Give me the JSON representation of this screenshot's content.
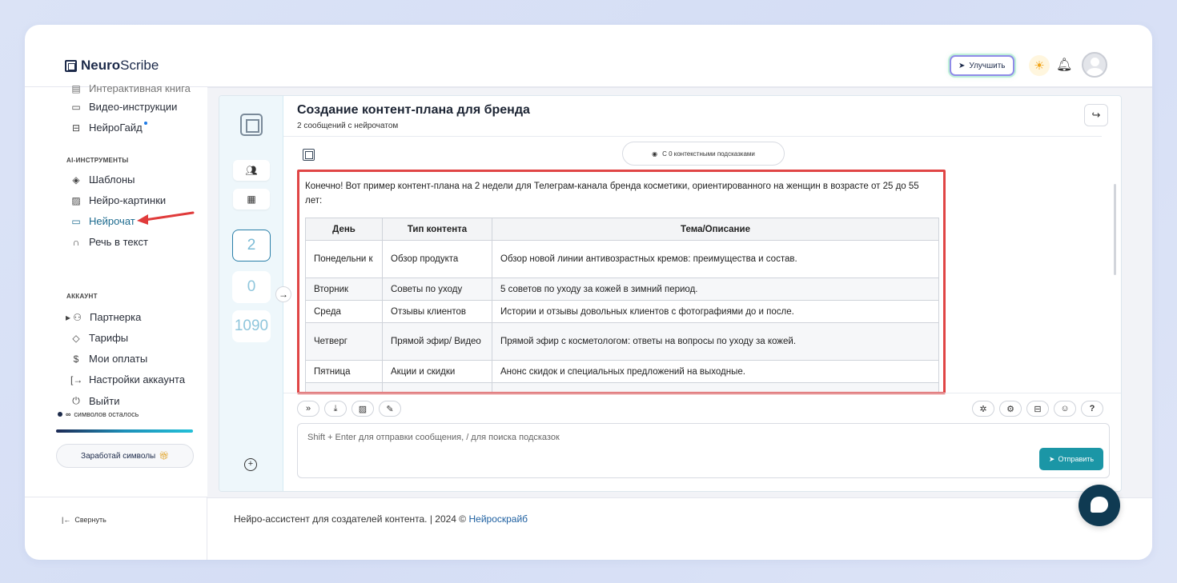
{
  "app": {
    "logo_bold": "Neuro",
    "logo_rest": "Scribe",
    "upgrade_label": "Улучшить"
  },
  "sidebar": {
    "cut_item": "Интерактивная книга",
    "items_top": [
      {
        "label": "Видео-инструкции",
        "icon": "video-icon"
      },
      {
        "label": "НейроГайд",
        "icon": "guide-icon"
      }
    ],
    "section_ai": "AI-ИНСТРУМЕНТЫ",
    "ai_items": [
      {
        "label": "Шаблоны",
        "icon": "layers-icon"
      },
      {
        "label": "Нейро-картинки",
        "icon": "image-icon"
      },
      {
        "label": "Нейрочат",
        "icon": "chat-icon"
      },
      {
        "label": "Речь в текст",
        "icon": "headphones-icon"
      }
    ],
    "section_account": "АККАУНТ",
    "account_items": [
      {
        "label": "Партнерка",
        "icon": "users-icon"
      },
      {
        "label": "Тарифы",
        "icon": "tag-icon"
      },
      {
        "label": "Мои оплаты",
        "icon": "dollar-icon"
      },
      {
        "label": "Настройки аккаунта",
        "icon": "login-icon"
      },
      {
        "label": "Выйти",
        "icon": "power-icon"
      }
    ],
    "symbols_infinity": "∞",
    "symbols_text": "символов осталось",
    "symbols_progress": 1.0,
    "earn_label": "Заработай символы",
    "collapse_label": "Свернуть"
  },
  "rail": {
    "counts": [
      "2",
      "0",
      "1090"
    ]
  },
  "chat": {
    "title": "Создание контент-плана для бренда",
    "subtitle": "2 сообщений с нейрочатом",
    "context_pill": "С 0 контекстными подсказками",
    "message_intro": "Конечно! Вот пример контент-плана на 2 недели для Телеграм-канала бренда косметики, ориентированного на женщин в возрасте от 25 до 55 лет:",
    "table_headers": [
      "День",
      "Тип контента",
      "Тема/Описание"
    ],
    "table_rows": [
      [
        "Понедельни к",
        "Обзор продукта",
        "Обзор новой линии антивозрастных кремов: преимущества и состав."
      ],
      [
        "Вторник",
        "Советы по уходу",
        "5 советов по уходу за кожей в зимний период."
      ],
      [
        "Среда",
        "Отзывы клиентов",
        "Истории и отзывы довольных клиентов с фотографиями до и после."
      ],
      [
        "Четверг",
        "Прямой эфир/ Видео",
        "Прямой эфир с косметологом: ответы на вопросы по уходу за кожей."
      ],
      [
        "Пятница",
        "Акции и скидки",
        "Анонс скидок и специальных предложений на выходные."
      ]
    ],
    "input_placeholder": "Shift + Enter для отправки сообщения, / для поиска подсказок",
    "send_label": "Отправить"
  },
  "footer": {
    "text": "Нейро-ассистент для создателей контента.  | 2024 © ",
    "link": "Нейроскрайб"
  },
  "colors": {
    "accent": "#1b96a6",
    "highlight_border": "#e04545",
    "active_nav": "#1d6b8f"
  }
}
